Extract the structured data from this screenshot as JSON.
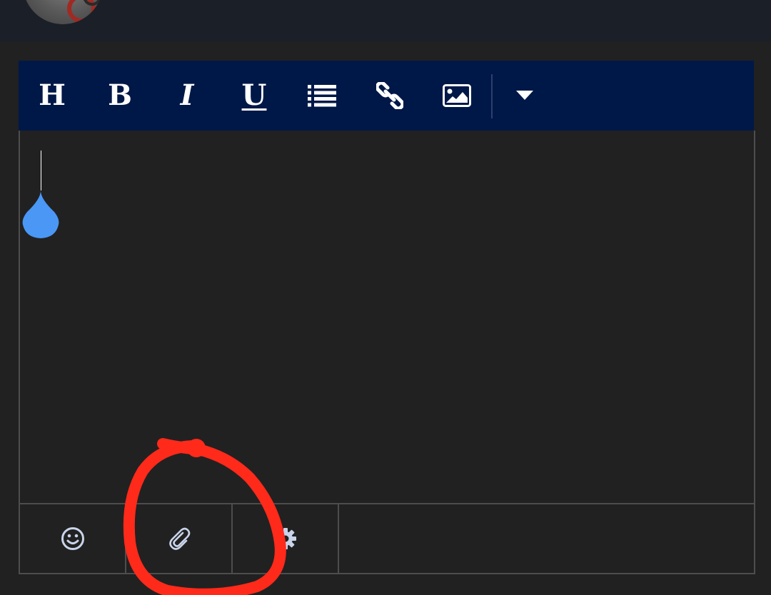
{
  "header": {
    "avatar_icon": "user-avatar"
  },
  "toolbar": {
    "background": "#001847",
    "buttons": [
      {
        "name": "heading",
        "label": "H",
        "icon": "heading-icon"
      },
      {
        "name": "bold",
        "label": "B",
        "icon": "bold-icon"
      },
      {
        "name": "italic",
        "label": "I",
        "icon": "italic-icon"
      },
      {
        "name": "underline",
        "label": "U",
        "icon": "underline-icon"
      },
      {
        "name": "list",
        "icon": "list-icon"
      },
      {
        "name": "link",
        "icon": "link-icon"
      },
      {
        "name": "image",
        "icon": "image-icon"
      },
      {
        "name": "more",
        "icon": "caret-down-icon"
      }
    ]
  },
  "editor": {
    "content": "",
    "caret_handle_color": "#4a97f5"
  },
  "actionbar": {
    "buttons": [
      {
        "name": "emoji",
        "icon": "smiley-icon"
      },
      {
        "name": "attach",
        "icon": "paperclip-icon"
      },
      {
        "name": "settings",
        "icon": "gear-icon"
      }
    ]
  },
  "annotation": {
    "color": "#ff2a1a",
    "shape": "hand-drawn circle around attach button"
  }
}
